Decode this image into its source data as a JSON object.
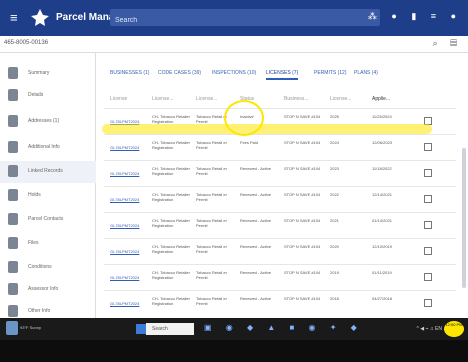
{
  "app": {
    "title": "Parcel Manager",
    "search_placeholder": "Search",
    "top_icons": "⁂ ● ▮ ≡ ●"
  },
  "record": {
    "id_text": "465-8005-00136",
    "icons": "⌕ ▤"
  },
  "sidebar": {
    "items": [
      {
        "label": "Summary"
      },
      {
        "label": "Details"
      },
      {
        "label": "Addresses (1)"
      },
      {
        "label": "Additional Info"
      },
      {
        "label": "Linked Records"
      },
      {
        "label": "Holds"
      },
      {
        "label": "Parcel Contacts"
      },
      {
        "label": "Files"
      },
      {
        "label": "Conditions"
      },
      {
        "label": "Assessor Info"
      },
      {
        "label": "Other Info"
      }
    ]
  },
  "tabs": [
    {
      "label": "BUSINESSES (1)"
    },
    {
      "label": "CODE CASES (39)"
    },
    {
      "label": "INSPECTIONS (10)"
    },
    {
      "label": "LICENSES (7)"
    },
    {
      "label": "PERMITS (12)"
    },
    {
      "label": "PLANS (4)"
    }
  ],
  "table": {
    "headers": [
      "License",
      "License...",
      "License...",
      "Status",
      "Business...",
      "License...",
      "Applie..."
    ],
    "rows": [
      {
        "id": "GL78LPMT2024",
        "type": "CH- Tobacco Retailer Registration",
        "desc": "Tobacco Retail er Permit",
        "status": "Inactive",
        "business": "STOP N SAVE #104",
        "year": "2025",
        "date": "11/25/2024"
      },
      {
        "id": "GL78LPMT2024",
        "type": "CH- Tobacco Retailer Registration",
        "desc": "Tobacco Retail er Permit",
        "status": "Fees Paid",
        "business": "STOP N SAVE #104",
        "year": "2024",
        "date": "12/06/2023"
      },
      {
        "id": "GL78LPMT2024",
        "type": "CH- Tobacco Retailer Registration",
        "desc": "Tobacco Retail er Permit",
        "status": "Renewed - Active",
        "business": "STOP N SAVE #104",
        "year": "2023",
        "date": "11/18/2022"
      },
      {
        "id": "GL78LPMT2024",
        "type": "CH- Tobacco Retailer Registration",
        "desc": "Tobacco Retail er Permit",
        "status": "Renewed - Active",
        "business": "STOP N SAVE #104",
        "year": "2022",
        "date": "12/14/2021"
      },
      {
        "id": "GL78LPMT2024",
        "type": "CH- Tobacco Retailer Registration",
        "desc": "Tobacco Retail er Permit",
        "status": "Renewed - Active",
        "business": "STOP N SAVE #104",
        "year": "2021",
        "date": "01/14/2021"
      },
      {
        "id": "GL78LPMT2024",
        "type": "CH- Tobacco Retailer Registration",
        "desc": "Tobacco Retail er Permit",
        "status": "Renewed - Active",
        "business": "STOP N SAVE #104",
        "year": "2020",
        "date": "12/10/2019"
      },
      {
        "id": "GL78LPMT2024",
        "type": "CH- Tobacco Retailer Registration",
        "desc": "Tobacco Retail er Permit",
        "status": "Renewed - Active",
        "business": "STOP N SAVE #104",
        "year": "2019",
        "date": "01/11/2019"
      },
      {
        "id": "GL78LPMT2024",
        "type": "CH- Tobacco Retailer Registration",
        "desc": "Tobacco Retail er Permit",
        "status": "Renewed - Active",
        "business": "STOP N SAVE #104",
        "year": "2018",
        "date": "04/27/2018"
      }
    ]
  },
  "taskbar": {
    "search_placeholder": "Search",
    "apps": "▣ ◉ ◆ ▲ ■ ◉ ✦ ◆",
    "tray": "^ ◀ ⌁ ♫ EN",
    "clock": "12:00 PM",
    "user_label": "93°F Sunny"
  },
  "colors": {
    "topbar": "#1f3e8a",
    "accent": "#2f5fb3",
    "highlight": "#ffe600"
  }
}
